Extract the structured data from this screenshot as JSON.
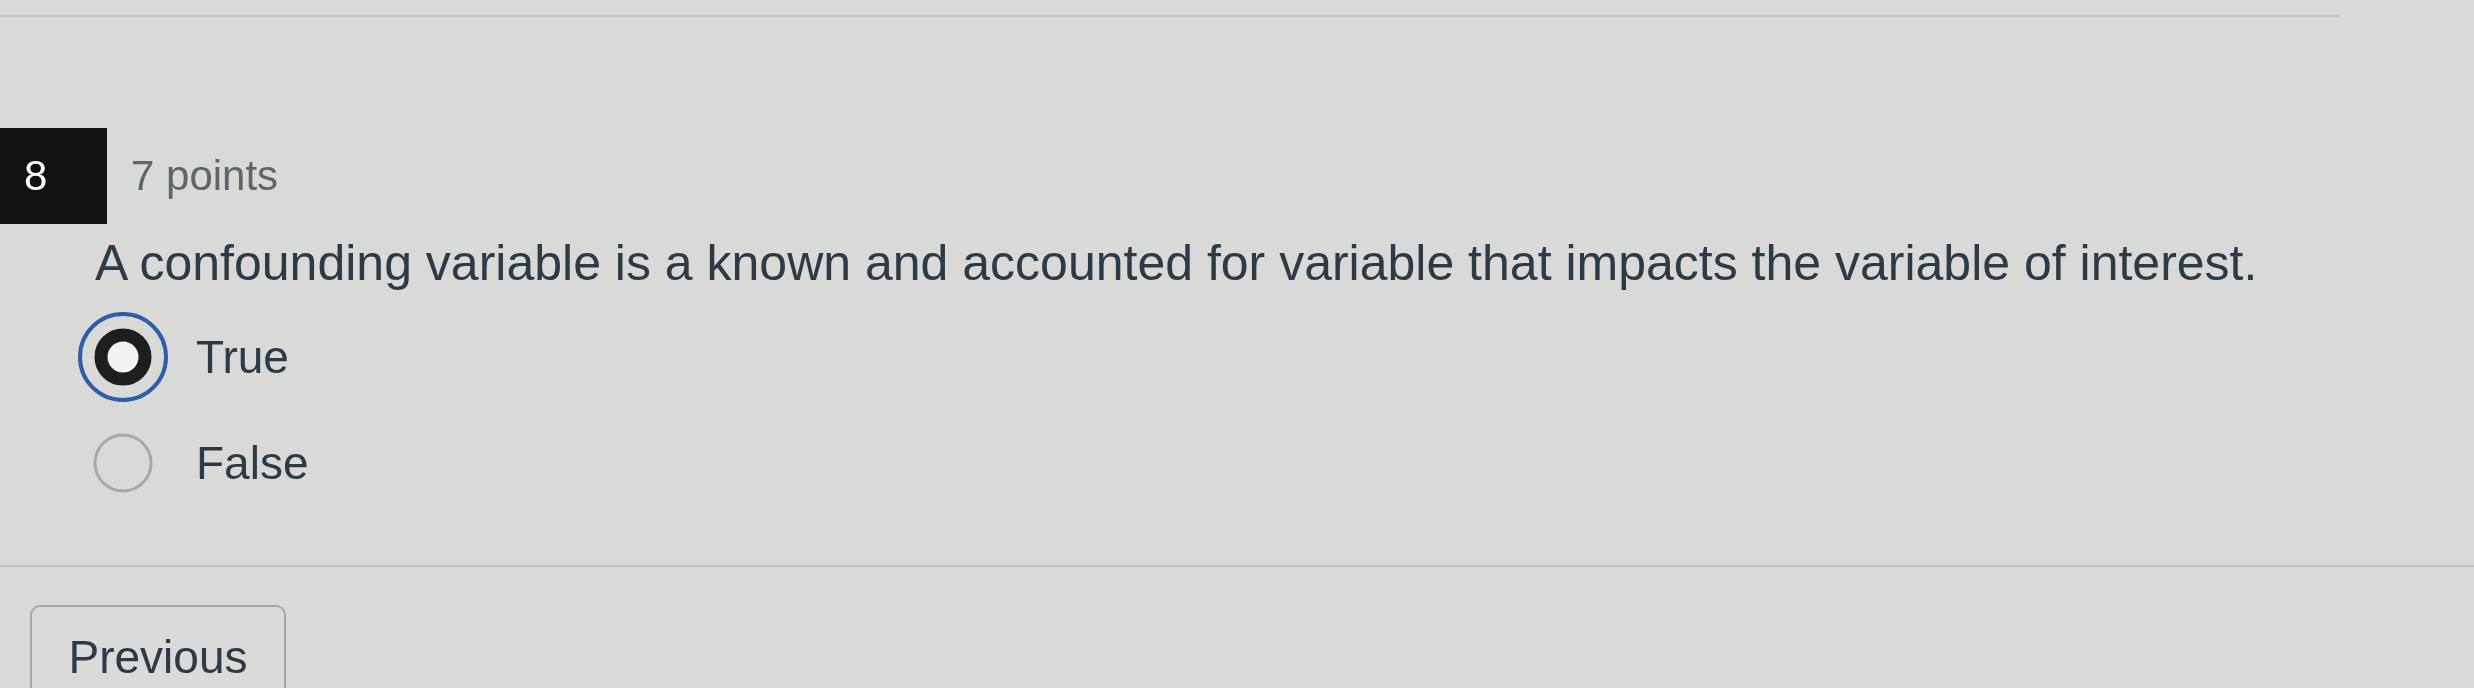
{
  "question": {
    "number": "8",
    "points": "7 points",
    "text": "A confounding variable is a known and accounted for variable that impacts the variable of interest."
  },
  "options": [
    {
      "label": "True",
      "selected": true
    },
    {
      "label": "False",
      "selected": false
    }
  ],
  "buttons": [
    {
      "label": "Previous"
    }
  ]
}
